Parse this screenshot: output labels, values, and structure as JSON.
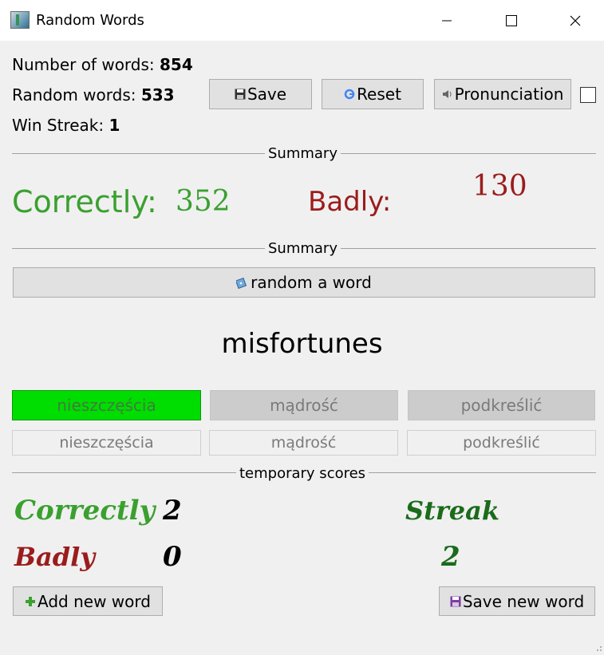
{
  "window": {
    "title": "Random Words"
  },
  "stats": {
    "words_label": "Number of words:",
    "words_value": "854",
    "random_label": "Random words:",
    "random_value": "533",
    "streak_label": "Win Streak:",
    "streak_value": "1"
  },
  "toolbar": {
    "save_label": "Save",
    "reset_label": "Reset",
    "pronunciation_label": "Pronunciation"
  },
  "summary": {
    "title": "Summary",
    "correct_label": "Correctly:",
    "correct_value": "352",
    "bad_label": "Badly:",
    "bad_value": "130",
    "title2": "Summary"
  },
  "random_button_label": "random a word",
  "current_word": "misfortunes",
  "answers_top": [
    "nieszczęścia",
    "mądrość",
    "podkreślić"
  ],
  "answers_bottom": [
    "nieszczęścia",
    "mądrość",
    "podkreślić"
  ],
  "temp": {
    "title": "temporary scores",
    "correct_label": "Correctly",
    "correct_value": "2",
    "bad_label": "Badly",
    "bad_value": "0",
    "streak_label": "Streak",
    "streak_value": "2"
  },
  "footer": {
    "add_label": "Add new word",
    "save_new_label": "Save new word"
  },
  "colors": {
    "correct": "#3aa02f",
    "bad": "#9b1c1c",
    "streak": "#1b6b1b",
    "correct_answer_bg": "#00dd00"
  },
  "icons": [
    "app-icon",
    "minimize-icon",
    "maximize-icon",
    "close-icon",
    "floppy-disk-icon",
    "google-g-icon",
    "speaker-icon",
    "dice-icon",
    "plus-icon",
    "save-disk-icon"
  ]
}
